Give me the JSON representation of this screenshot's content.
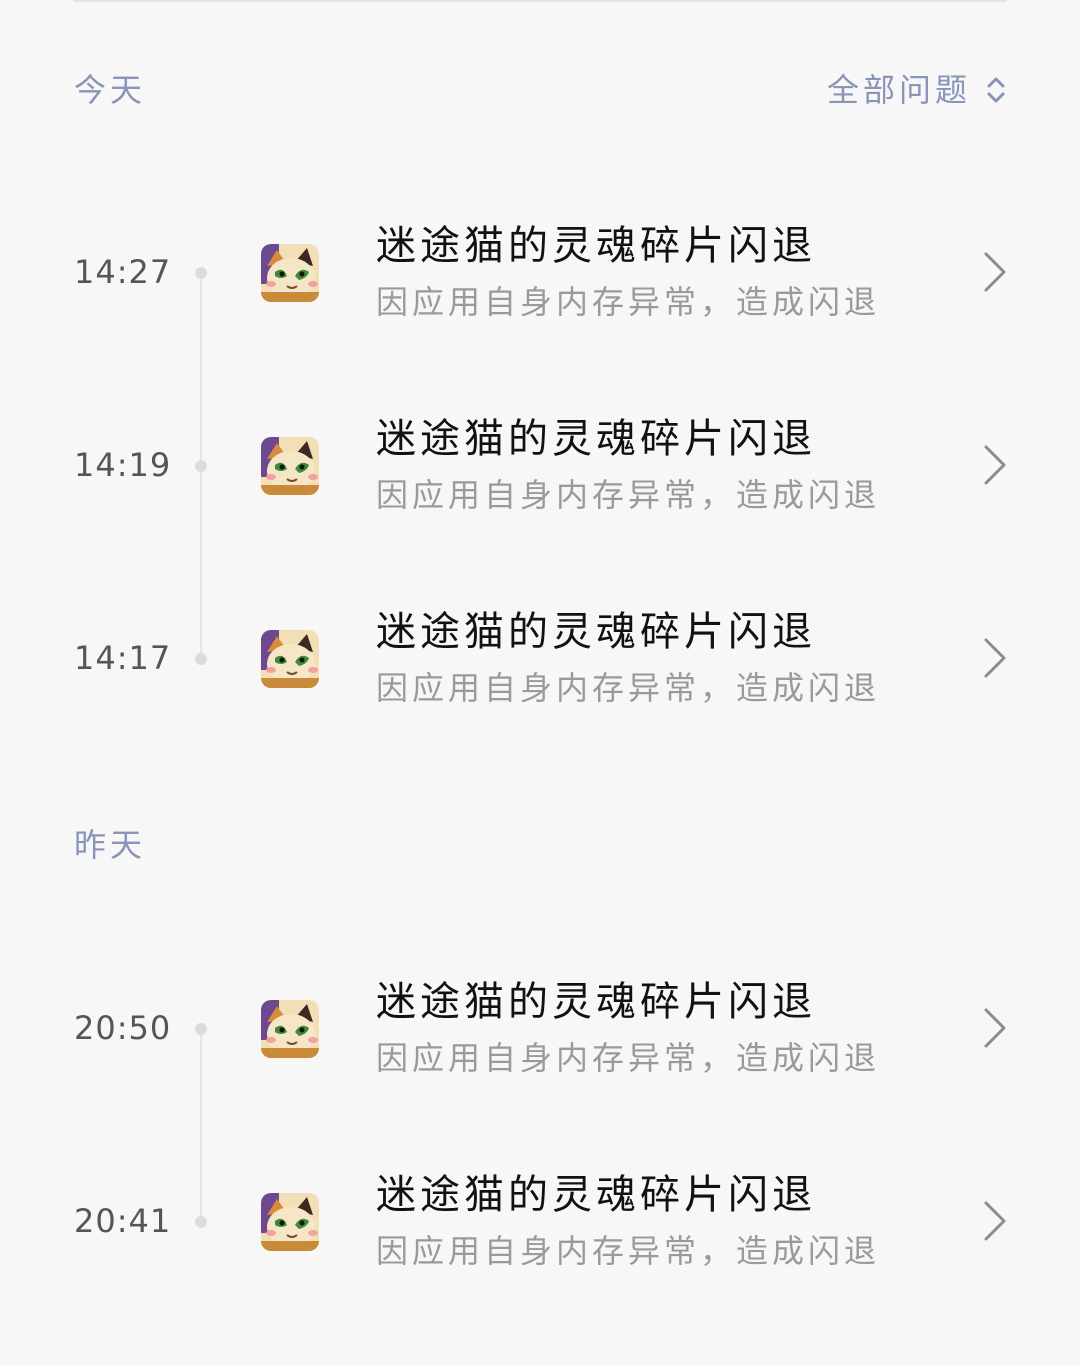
{
  "header": {
    "section_today": "今天",
    "filter_label": "全部问题",
    "filter_icon": "sort-updown-icon"
  },
  "sections": [
    {
      "label": "今天",
      "items": [
        {
          "time": "14:27",
          "title": "迷途猫的灵魂碎片闪退",
          "subtitle": "因应用自身内存异常，造成闪退"
        },
        {
          "time": "14:19",
          "title": "迷途猫的灵魂碎片闪退",
          "subtitle": "因应用自身内存异常，造成闪退"
        },
        {
          "time": "14:17",
          "title": "迷途猫的灵魂碎片闪退",
          "subtitle": "因应用自身内存异常，造成闪退"
        }
      ]
    },
    {
      "label": "昨天",
      "items": [
        {
          "time": "20:50",
          "title": "迷途猫的灵魂碎片闪退",
          "subtitle": "因应用自身内存异常，造成闪退"
        },
        {
          "time": "20:41",
          "title": "迷途猫的灵魂碎片闪退",
          "subtitle": "因应用自身内存异常，造成闪退"
        }
      ]
    }
  ],
  "colors": {
    "background": "#f7f7f7",
    "section_label": "#8a93b8",
    "title": "#111111",
    "subtitle": "#9a9a9a",
    "timeline": "#e6e6e6"
  },
  "icons": {
    "app": "cat-app-icon",
    "row_action": "chevron-right-icon"
  }
}
